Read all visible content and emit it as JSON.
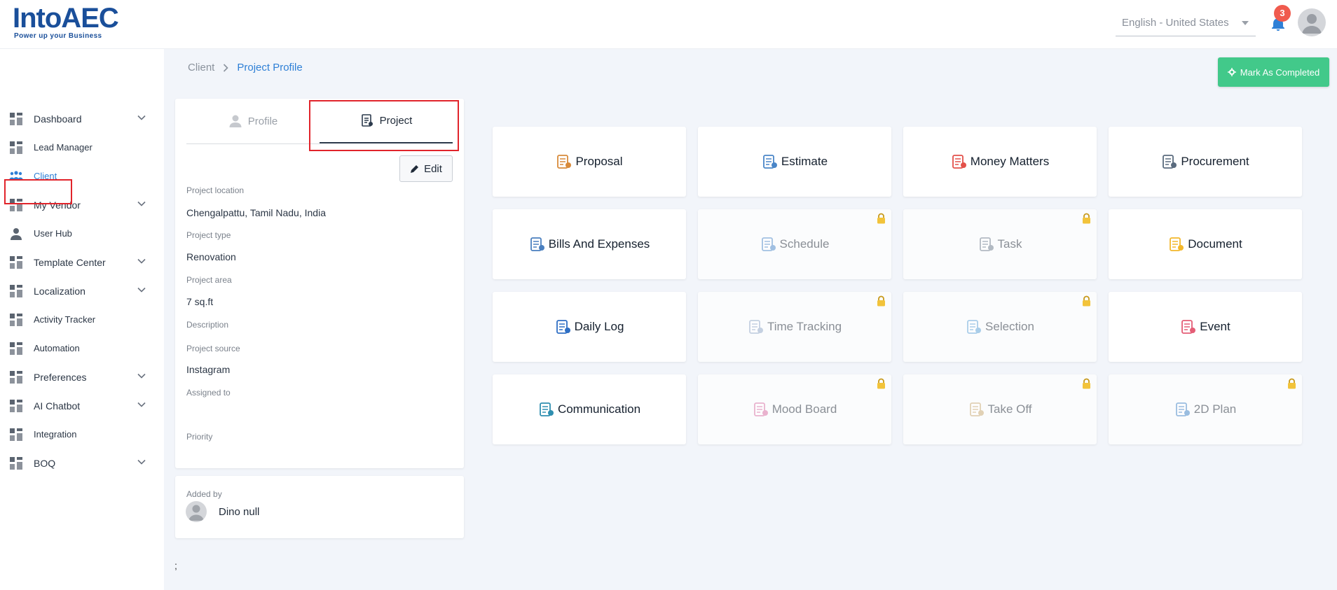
{
  "brand": {
    "name": "IntoAEC",
    "tagline": "Power up your Business"
  },
  "header": {
    "language": "English - United States",
    "notifications": "3"
  },
  "sidebar": {
    "items": [
      {
        "label": "Dashboard",
        "icon": "dashboard-icon",
        "chevron": true
      },
      {
        "label": "Lead Manager",
        "icon": "lead-manager-icon",
        "chevron": false
      },
      {
        "label": "Client",
        "icon": "client-icon",
        "chevron": false,
        "active": true
      },
      {
        "label": "My Vendor",
        "icon": "vendor-icon",
        "chevron": true
      },
      {
        "label": "User Hub",
        "icon": "user-icon",
        "chevron": false
      },
      {
        "label": "Template Center",
        "icon": "template-icon",
        "chevron": true
      },
      {
        "label": "Localization",
        "icon": "localization-icon",
        "chevron": true
      },
      {
        "label": "Activity Tracker",
        "icon": "activity-icon",
        "chevron": false
      },
      {
        "label": "Automation",
        "icon": "automation-icon",
        "chevron": false
      },
      {
        "label": "Preferences",
        "icon": "preferences-icon",
        "chevron": true
      },
      {
        "label": "AI Chatbot",
        "icon": "chatbot-icon",
        "chevron": true
      },
      {
        "label": "Integration",
        "icon": "integration-icon",
        "chevron": false
      },
      {
        "label": "BOQ",
        "icon": "boq-icon",
        "chevron": true
      }
    ]
  },
  "breadcrumb": {
    "parent": "Client",
    "current": "Project Profile"
  },
  "actions": {
    "mark_completed": "Mark As Completed",
    "edit": "Edit"
  },
  "tabs": {
    "profile": "Profile",
    "project": "Project"
  },
  "project": {
    "location_label": "Project location",
    "location": "Chengalpattu, Tamil Nadu, India",
    "type_label": "Project type",
    "type": "Renovation",
    "area_label": "Project area",
    "area": "7 sq.ft",
    "description_label": "Description",
    "source_label": "Project source",
    "source": "Instagram",
    "assigned_label": "Assigned to",
    "priority_label": "Priority"
  },
  "added_by": {
    "label": "Added by",
    "name": "Dino null"
  },
  "footer_text": ";",
  "modules": [
    {
      "label": "Proposal",
      "locked": false,
      "color": "#d88a3a"
    },
    {
      "label": "Estimate",
      "locked": false,
      "color": "#4a86c8"
    },
    {
      "label": "Money Matters",
      "locked": false,
      "color": "#e3514a"
    },
    {
      "label": "Procurement",
      "locked": false,
      "color": "#5a6b7e"
    },
    {
      "label": "Bills And Expenses",
      "locked": false,
      "color": "#4a7fbf"
    },
    {
      "label": "Schedule",
      "locked": true,
      "color": "#4a86c8"
    },
    {
      "label": "Task",
      "locked": true,
      "color": "#6c7a8a"
    },
    {
      "label": "Document",
      "locked": false,
      "color": "#f3b72b"
    },
    {
      "label": "Daily Log",
      "locked": false,
      "color": "#2f6fc4"
    },
    {
      "label": "Time Tracking",
      "locked": true,
      "color": "#8fa6c6"
    },
    {
      "label": "Selection",
      "locked": true,
      "color": "#5aa0d6"
    },
    {
      "label": "Event",
      "locked": false,
      "color": "#e45d76"
    },
    {
      "label": "Communication",
      "locked": false,
      "color": "#2f8fb0"
    },
    {
      "label": "Mood Board",
      "locked": true,
      "color": "#d86ba0"
    },
    {
      "label": "Take Off",
      "locked": true,
      "color": "#c9a870"
    },
    {
      "label": "2D Plan",
      "locked": true,
      "color": "#3b7fc4"
    }
  ]
}
